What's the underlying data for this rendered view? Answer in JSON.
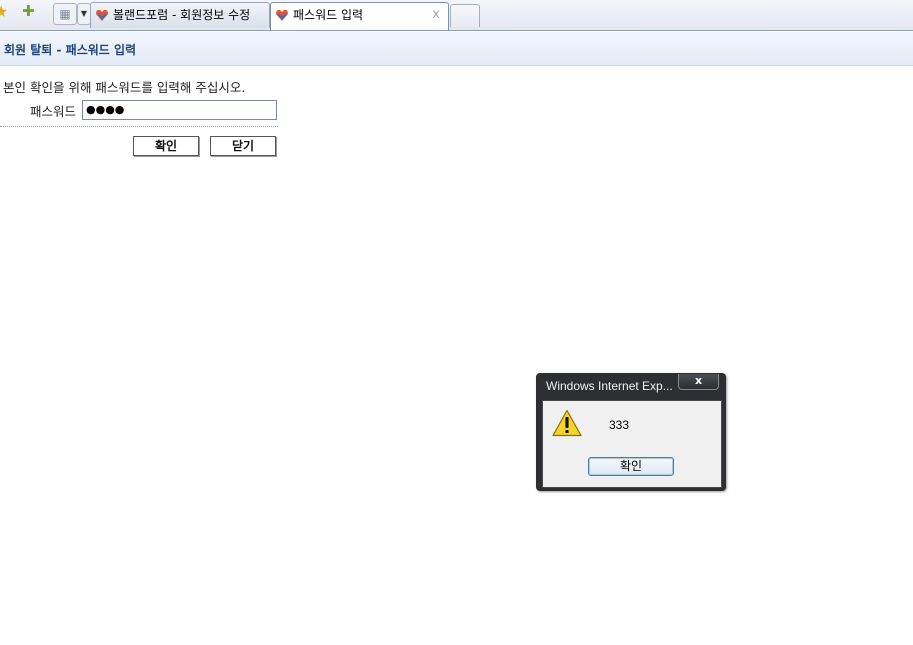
{
  "browser": {
    "tabs": [
      {
        "label": "볼랜드포럼 - 회원정보 수정",
        "active": false
      },
      {
        "label": "패스워드 입력",
        "active": true
      }
    ],
    "close_glyph": "x"
  },
  "page": {
    "title": "회원 탈퇴 - 패스워드 입력",
    "instruction": "본인 확인을 위해 패스워드를 입력해 주십시오.",
    "password_label": "패스워드",
    "password_value": "●●●●",
    "confirm_label": "확인",
    "close_label": "닫기"
  },
  "dialog": {
    "title": "Windows Internet Exp...",
    "close_glyph": "x",
    "message": "333",
    "ok_label": "확인",
    "icon": "warning-icon"
  },
  "colors": {
    "header_text": "#23457c",
    "header_bg": "#e4ecf8",
    "dialog_frame": "#2d2f33",
    "warning_yellow": "#f6d32a"
  }
}
